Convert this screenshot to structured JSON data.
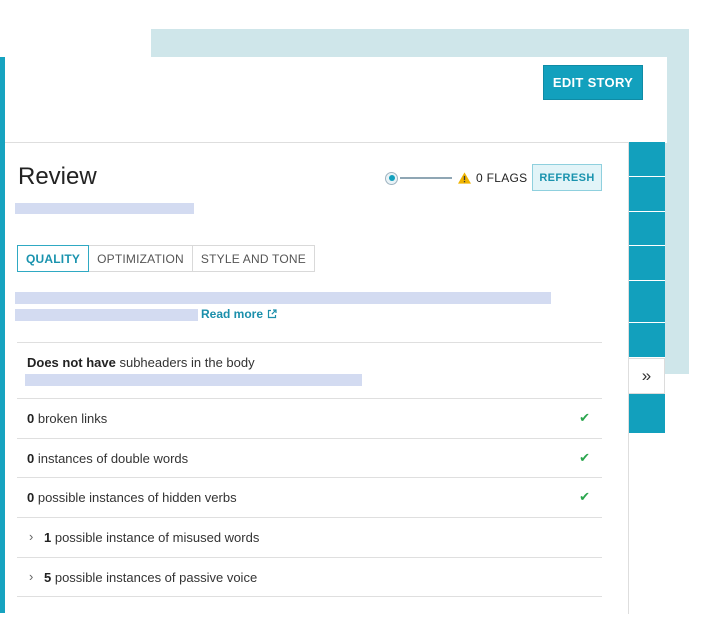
{
  "header": {
    "edit_story_label": "EDIT STORY"
  },
  "review": {
    "title": "Review",
    "flags_label": "0 FLAGS",
    "refresh_label": "REFRESH",
    "tabs": [
      {
        "label": "QUALITY",
        "active": true
      },
      {
        "label": "OPTIMIZATION",
        "active": false
      },
      {
        "label": "STYLE AND TONE",
        "active": false
      }
    ],
    "read_more_label": "Read more"
  },
  "checks": [
    {
      "count": "Does not have",
      "text": " subheaders in the body",
      "status": "none"
    },
    {
      "count": "0",
      "text": " broken links",
      "status": "pass"
    },
    {
      "count": "0",
      "text": " instances of double words",
      "status": "pass"
    },
    {
      "count": "0",
      "text": " possible instances of hidden verbs",
      "status": "pass"
    },
    {
      "count": "1",
      "text": " possible instance of misused words",
      "status": "expandable"
    },
    {
      "count": "5",
      "text": " possible instances of passive voice",
      "status": "expandable"
    }
  ],
  "sidebar": {
    "collapse_glyph": "»"
  },
  "colors": {
    "accent": "#12a0bd",
    "pass": "#2aa64d",
    "warning": "#f0b400",
    "skeleton": "#d3dbf1",
    "backdrop": "#cfe6ea"
  },
  "icons": [
    "warning-icon",
    "external-link-icon",
    "check-icon",
    "chevron-right-icon",
    "double-chevron-right-icon"
  ]
}
